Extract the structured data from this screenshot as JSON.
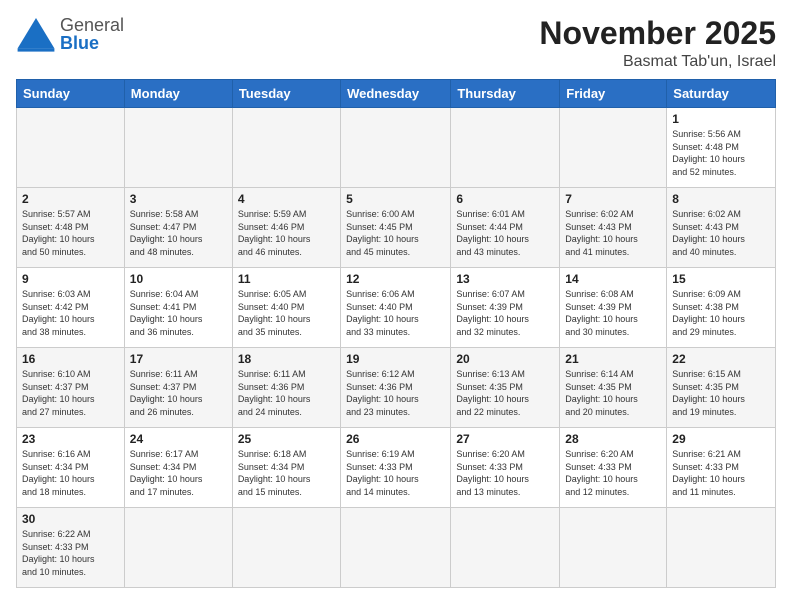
{
  "header": {
    "logo_general": "General",
    "logo_blue": "Blue",
    "month_title": "November 2025",
    "location": "Basmat Tab'un, Israel"
  },
  "weekdays": [
    "Sunday",
    "Monday",
    "Tuesday",
    "Wednesday",
    "Thursday",
    "Friday",
    "Saturday"
  ],
  "weeks": [
    [
      {
        "day": "",
        "info": ""
      },
      {
        "day": "",
        "info": ""
      },
      {
        "day": "",
        "info": ""
      },
      {
        "day": "",
        "info": ""
      },
      {
        "day": "",
        "info": ""
      },
      {
        "day": "",
        "info": ""
      },
      {
        "day": "1",
        "info": "Sunrise: 5:56 AM\nSunset: 4:48 PM\nDaylight: 10 hours\nand 52 minutes."
      }
    ],
    [
      {
        "day": "2",
        "info": "Sunrise: 5:57 AM\nSunset: 4:48 PM\nDaylight: 10 hours\nand 50 minutes."
      },
      {
        "day": "3",
        "info": "Sunrise: 5:58 AM\nSunset: 4:47 PM\nDaylight: 10 hours\nand 48 minutes."
      },
      {
        "day": "4",
        "info": "Sunrise: 5:59 AM\nSunset: 4:46 PM\nDaylight: 10 hours\nand 46 minutes."
      },
      {
        "day": "5",
        "info": "Sunrise: 6:00 AM\nSunset: 4:45 PM\nDaylight: 10 hours\nand 45 minutes."
      },
      {
        "day": "6",
        "info": "Sunrise: 6:01 AM\nSunset: 4:44 PM\nDaylight: 10 hours\nand 43 minutes."
      },
      {
        "day": "7",
        "info": "Sunrise: 6:02 AM\nSunset: 4:43 PM\nDaylight: 10 hours\nand 41 minutes."
      },
      {
        "day": "8",
        "info": "Sunrise: 6:02 AM\nSunset: 4:43 PM\nDaylight: 10 hours\nand 40 minutes."
      }
    ],
    [
      {
        "day": "9",
        "info": "Sunrise: 6:03 AM\nSunset: 4:42 PM\nDaylight: 10 hours\nand 38 minutes."
      },
      {
        "day": "10",
        "info": "Sunrise: 6:04 AM\nSunset: 4:41 PM\nDaylight: 10 hours\nand 36 minutes."
      },
      {
        "day": "11",
        "info": "Sunrise: 6:05 AM\nSunset: 4:40 PM\nDaylight: 10 hours\nand 35 minutes."
      },
      {
        "day": "12",
        "info": "Sunrise: 6:06 AM\nSunset: 4:40 PM\nDaylight: 10 hours\nand 33 minutes."
      },
      {
        "day": "13",
        "info": "Sunrise: 6:07 AM\nSunset: 4:39 PM\nDaylight: 10 hours\nand 32 minutes."
      },
      {
        "day": "14",
        "info": "Sunrise: 6:08 AM\nSunset: 4:39 PM\nDaylight: 10 hours\nand 30 minutes."
      },
      {
        "day": "15",
        "info": "Sunrise: 6:09 AM\nSunset: 4:38 PM\nDaylight: 10 hours\nand 29 minutes."
      }
    ],
    [
      {
        "day": "16",
        "info": "Sunrise: 6:10 AM\nSunset: 4:37 PM\nDaylight: 10 hours\nand 27 minutes."
      },
      {
        "day": "17",
        "info": "Sunrise: 6:11 AM\nSunset: 4:37 PM\nDaylight: 10 hours\nand 26 minutes."
      },
      {
        "day": "18",
        "info": "Sunrise: 6:11 AM\nSunset: 4:36 PM\nDaylight: 10 hours\nand 24 minutes."
      },
      {
        "day": "19",
        "info": "Sunrise: 6:12 AM\nSunset: 4:36 PM\nDaylight: 10 hours\nand 23 minutes."
      },
      {
        "day": "20",
        "info": "Sunrise: 6:13 AM\nSunset: 4:35 PM\nDaylight: 10 hours\nand 22 minutes."
      },
      {
        "day": "21",
        "info": "Sunrise: 6:14 AM\nSunset: 4:35 PM\nDaylight: 10 hours\nand 20 minutes."
      },
      {
        "day": "22",
        "info": "Sunrise: 6:15 AM\nSunset: 4:35 PM\nDaylight: 10 hours\nand 19 minutes."
      }
    ],
    [
      {
        "day": "23",
        "info": "Sunrise: 6:16 AM\nSunset: 4:34 PM\nDaylight: 10 hours\nand 18 minutes."
      },
      {
        "day": "24",
        "info": "Sunrise: 6:17 AM\nSunset: 4:34 PM\nDaylight: 10 hours\nand 17 minutes."
      },
      {
        "day": "25",
        "info": "Sunrise: 6:18 AM\nSunset: 4:34 PM\nDaylight: 10 hours\nand 15 minutes."
      },
      {
        "day": "26",
        "info": "Sunrise: 6:19 AM\nSunset: 4:33 PM\nDaylight: 10 hours\nand 14 minutes."
      },
      {
        "day": "27",
        "info": "Sunrise: 6:20 AM\nSunset: 4:33 PM\nDaylight: 10 hours\nand 13 minutes."
      },
      {
        "day": "28",
        "info": "Sunrise: 6:20 AM\nSunset: 4:33 PM\nDaylight: 10 hours\nand 12 minutes."
      },
      {
        "day": "29",
        "info": "Sunrise: 6:21 AM\nSunset: 4:33 PM\nDaylight: 10 hours\nand 11 minutes."
      }
    ],
    [
      {
        "day": "30",
        "info": "Sunrise: 6:22 AM\nSunset: 4:33 PM\nDaylight: 10 hours\nand 10 minutes."
      },
      {
        "day": "",
        "info": ""
      },
      {
        "day": "",
        "info": ""
      },
      {
        "day": "",
        "info": ""
      },
      {
        "day": "",
        "info": ""
      },
      {
        "day": "",
        "info": ""
      },
      {
        "day": "",
        "info": ""
      }
    ]
  ]
}
